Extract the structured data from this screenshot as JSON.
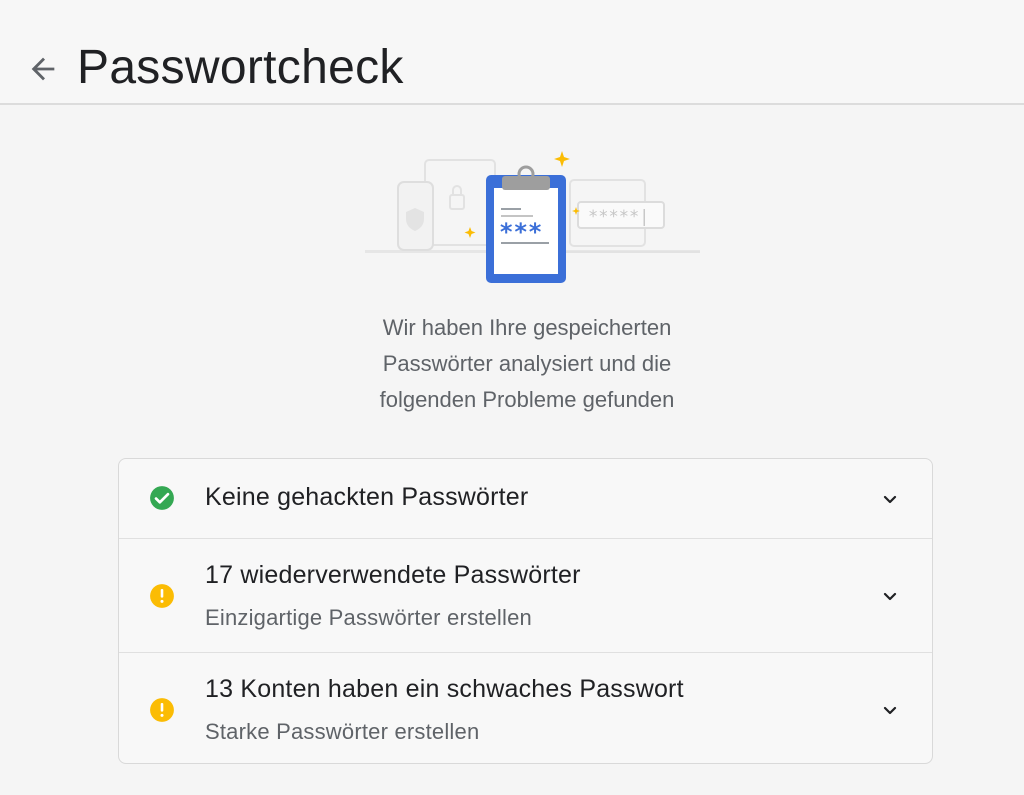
{
  "header": {
    "title": "Passwortcheck",
    "back_icon": "arrow-back-icon"
  },
  "illustration": {
    "clipboard_text": "***",
    "password_field_text": "*****|"
  },
  "description": {
    "lines": [
      "Wir haben Ihre gespeicherten",
      "Passwörter analysiert und die",
      "folgenden Probleme gefunden"
    ]
  },
  "checks": [
    {
      "title": "Keine gehackten Passwörter",
      "subtitle": "",
      "status": "ok",
      "status_icon": "check-circle-icon",
      "status_color": "#34a853"
    },
    {
      "title": "17 wiederverwendete Passwörter",
      "subtitle": "Einzigartige Passwörter erstellen",
      "status": "warning",
      "status_icon": "warning-circle-icon",
      "status_color": "#fbbc04"
    },
    {
      "title": "13 Konten haben ein schwaches Passwort",
      "subtitle": "Starke Passwörter erstellen",
      "status": "warning",
      "status_icon": "warning-circle-icon",
      "status_color": "#fbbc04"
    }
  ],
  "colors": {
    "accent_blue": "#4285f4",
    "sparkle": "#fbbc04"
  }
}
